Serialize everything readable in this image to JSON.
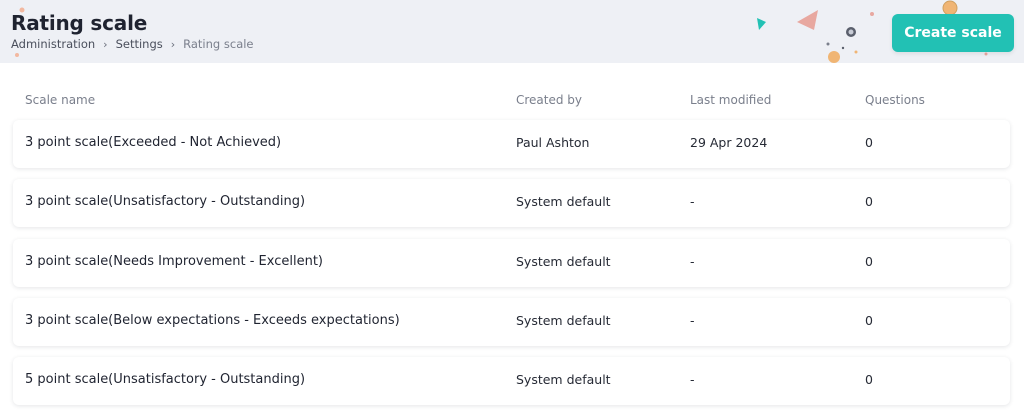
{
  "page": {
    "title": "Rating scale",
    "breadcrumb": [
      "Administration",
      "Settings",
      "Rating scale"
    ]
  },
  "actions": {
    "create_label": "Create scale"
  },
  "colors": {
    "accent": "#22c1b4",
    "header_bg": "#eef0f5"
  },
  "table": {
    "columns": [
      "Scale name",
      "Created by",
      "Last modified",
      "Questions"
    ],
    "rows": [
      {
        "name": "3 point scale(Exceeded - Not Achieved)",
        "created_by": "Paul Ashton",
        "modified": "29 Apr 2024",
        "questions": "0"
      },
      {
        "name": "3 point scale(Unsatisfactory - Outstanding)",
        "created_by": "System default",
        "modified": "-",
        "questions": "0"
      },
      {
        "name": "3 point scale(Needs Improvement - Excellent)",
        "created_by": "System default",
        "modified": "-",
        "questions": "0"
      },
      {
        "name": "3 point scale(Below expectations - Exceeds expectations)",
        "created_by": "System default",
        "modified": "-",
        "questions": "0"
      },
      {
        "name": "5 point scale(Unsatisfactory - Outstanding)",
        "created_by": "System default",
        "modified": "-",
        "questions": "0"
      }
    ]
  }
}
